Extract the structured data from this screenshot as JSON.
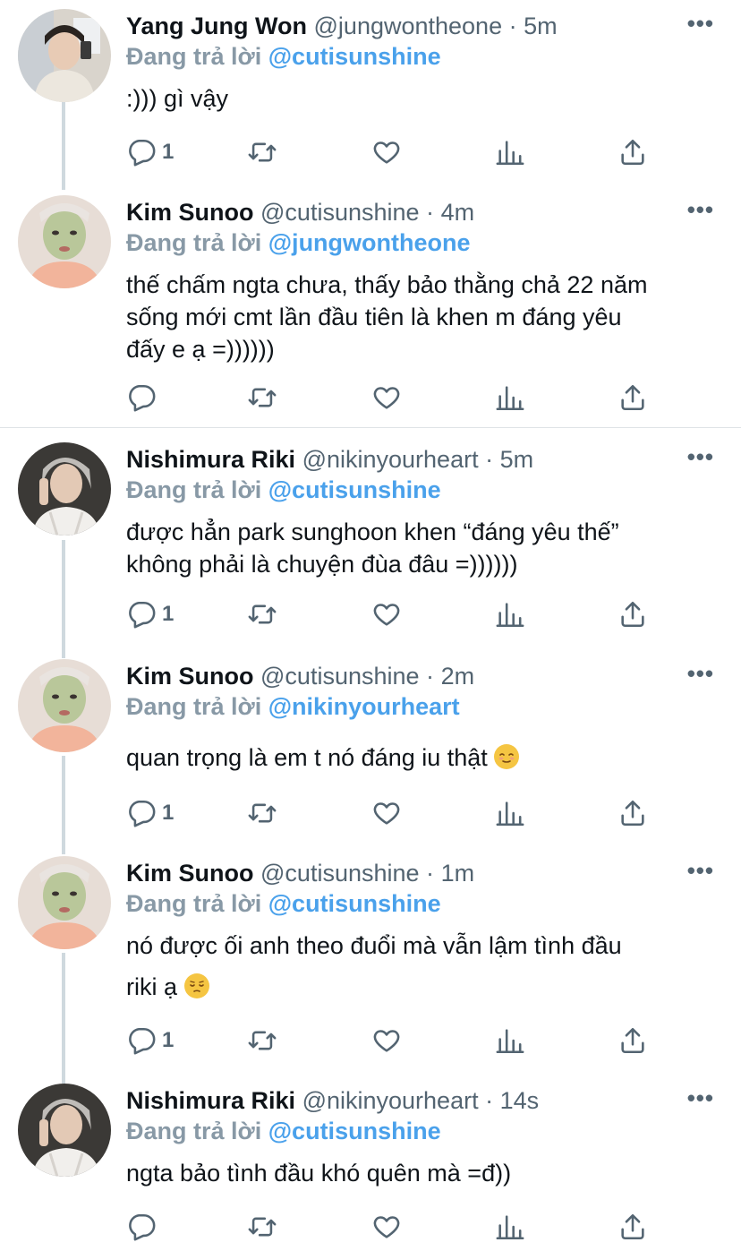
{
  "tweets": [
    {
      "name": "Yang Jung Won",
      "handle": "@jungwontheone",
      "time": "5m",
      "reply_prefix": "Đang trả lời",
      "reply_to": "@cutisunshine",
      "text_lines": [
        ":))) gì vậy"
      ],
      "reply_count": "1",
      "avatar": "avatar-jungwon"
    },
    {
      "name": "Kim Sunoo",
      "handle": "@cutisunshine",
      "time": "4m",
      "reply_prefix": "Đang trả lời",
      "reply_to": "@jungwontheone",
      "text_lines": [
        "thế chấm ngta chưa, thấy bảo thằng chả 22 năm",
        "sống mới cmt lần đầu tiên là khen m đáng yêu",
        "đấy e ạ =))))))"
      ],
      "reply_count": "",
      "avatar": "avatar-sunoo"
    },
    {
      "name": "Nishimura Riki",
      "handle": "@nikinyourheart",
      "time": "5m",
      "reply_prefix": "Đang trả lời",
      "reply_to": "@cutisunshine",
      "text_lines": [
        "được hẳn park sunghoon khen “đáng yêu thế”",
        "không phải là chuyện đùa đâu =))))))"
      ],
      "reply_count": "1",
      "avatar": "avatar-riki"
    },
    {
      "name": "Kim Sunoo",
      "handle": "@cutisunshine",
      "time": "2m",
      "reply_prefix": "Đang trả lời",
      "reply_to": "@nikinyourheart",
      "text_lines": [
        "quan trọng là em t nó đáng iu thật"
      ],
      "reply_count": "1",
      "avatar": "avatar-sunoo",
      "emoji": "relieved-face-emoji"
    },
    {
      "name": "Kim Sunoo",
      "handle": "@cutisunshine",
      "time": "1m",
      "reply_prefix": "Đang trả lời",
      "reply_to": "@cutisunshine",
      "text_lines": [
        "nó được ối anh theo đuổi mà vẫn lậm tình đầu",
        "riki ạ"
      ],
      "reply_count": "1",
      "avatar": "avatar-sunoo",
      "emoji": "pensive-face-emoji"
    },
    {
      "name": "Nishimura Riki",
      "handle": "@nikinyourheart",
      "time": "14s",
      "reply_prefix": "Đang trả lời",
      "reply_to": "@cutisunshine",
      "text_lines": [
        "ngta bảo tình đầu khó quên mà =đ))"
      ],
      "reply_count": "",
      "avatar": "avatar-riki"
    }
  ],
  "ui": {
    "dot": "·",
    "more": "•••",
    "icons": [
      "reply-icon",
      "retweet-icon",
      "like-icon",
      "analytics-icon",
      "share-icon"
    ]
  },
  "colors": {
    "accent": "#4aa1eb",
    "muted": "#536471",
    "reply_prefix": "#8899a6",
    "thread_line": "#cfd9de"
  }
}
